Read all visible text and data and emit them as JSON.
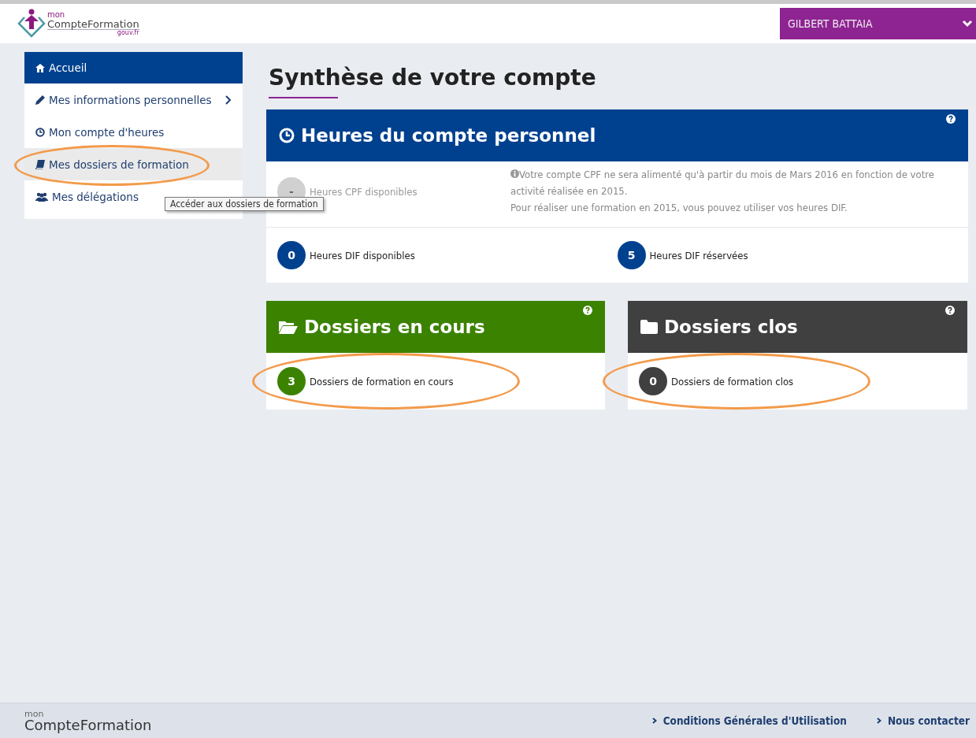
{
  "header": {
    "logo": {
      "small": "mon",
      "main": "CompteFormation",
      "suffix": "gouv.fr"
    },
    "user_menu": {
      "name": "GILBERT BATTAIA",
      "expanded": false
    }
  },
  "sidebar": {
    "items": [
      {
        "label": "Accueil",
        "selected": true,
        "hovered": false,
        "has_submenu": false
      },
      {
        "label": "Mes informations personnelles",
        "selected": false,
        "hovered": false,
        "has_submenu": true
      },
      {
        "label": "Mon compte d'heures",
        "selected": false,
        "hovered": false,
        "has_submenu": false
      },
      {
        "label": "Mes dossiers de formation",
        "selected": false,
        "hovered": true,
        "has_submenu": false,
        "annotated": true
      },
      {
        "label": "Mes délégations",
        "selected": false,
        "hovered": false,
        "has_submenu": false
      }
    ]
  },
  "tooltip": "Accéder aux dossiers de formation",
  "page_title": "Synthèse de votre compte",
  "hours_card": {
    "title": "Heures du compte personnel",
    "color": "#00418f",
    "cpf": {
      "value": "-",
      "label": "Heures CPF disponibles",
      "disabled": true
    },
    "note": [
      "Votre compte CPF ne sera alimenté qu'à partir du mois de Mars 2016 en fonction de votre activité réalisée en 2015.",
      "Pour réaliser une formation en 2015, vous pouvez utiliser vos heures DIF."
    ],
    "dif": [
      {
        "value": "0",
        "label": "Heures DIF disponibles",
        "disabled": false
      },
      {
        "value": "5",
        "label": "Heures DIF réservées",
        "disabled": false
      }
    ]
  },
  "folder_cards": [
    {
      "title": "Dossiers en cours",
      "color": "#3b8200",
      "kind": "open",
      "count": "3",
      "label": "Dossiers de formation en cours",
      "annotated": true
    },
    {
      "title": "Dossiers clos",
      "color": "#404040",
      "kind": "closed",
      "count": "0",
      "label": "Dossiers de formation clos",
      "annotated": true
    }
  ],
  "footer": {
    "logo": {
      "small": "mon",
      "main": "CompteFormation"
    },
    "links": [
      "Conditions Générales d'Utilisation",
      "Nous contacter"
    ]
  }
}
